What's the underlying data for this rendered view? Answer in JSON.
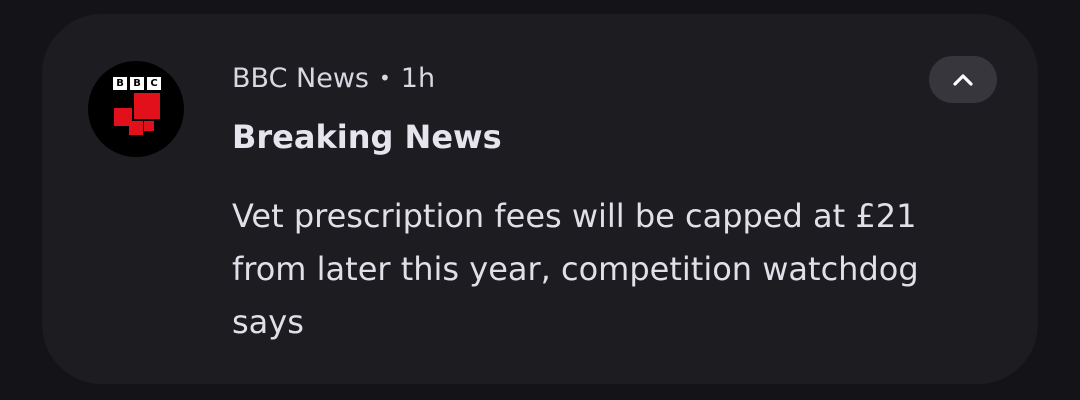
{
  "notification": {
    "app_name": "BBC News",
    "separator": "•",
    "time": "1h",
    "title": "Breaking News",
    "body": "Vet prescription fees will be capped at £21 from later this year, competition watchdog says",
    "app_icon": "bbc-news-icon",
    "logo_letters": [
      "B",
      "B",
      "C"
    ],
    "expand_icon": "chevron-up-icon"
  },
  "colors": {
    "background": "#141318",
    "card": "#1d1c21",
    "expand_button": "#37363d",
    "brand_red": "#e2101a",
    "text_primary": "#e6e4ec"
  }
}
